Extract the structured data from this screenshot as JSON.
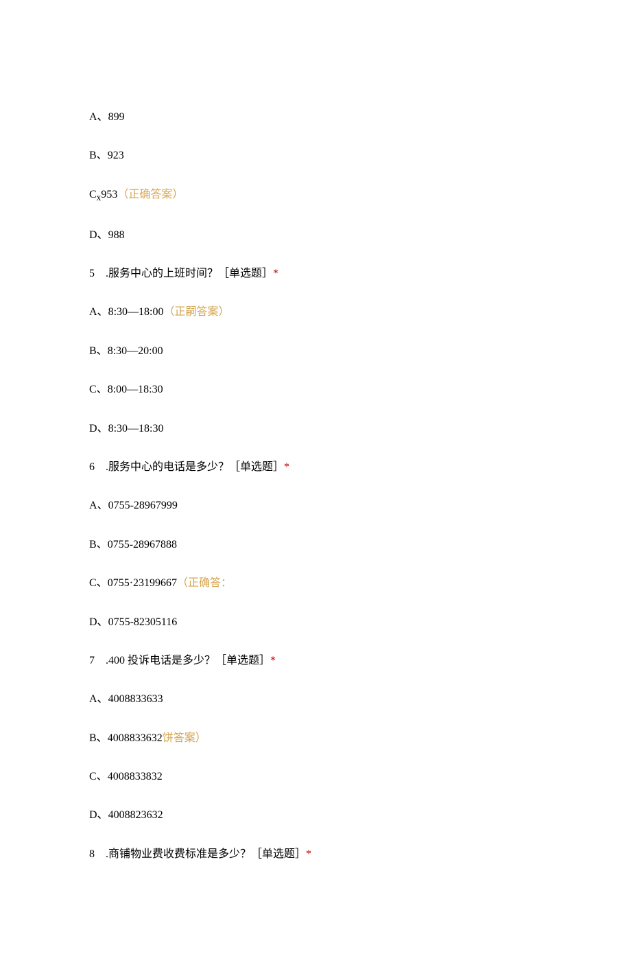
{
  "lines": [
    {
      "type": "option",
      "label": "A、",
      "value": "899"
    },
    {
      "type": "option",
      "label": "B、",
      "value": "923"
    },
    {
      "type": "option",
      "label": "C",
      "sub": "x",
      "value": "953",
      "correct": "（正确答案）"
    },
    {
      "type": "option",
      "label": "D、",
      "value": "988"
    },
    {
      "type": "question",
      "num": "5",
      "text": ".服务中心的上班时间？［单选题］",
      "req": "*"
    },
    {
      "type": "option",
      "label": "A、",
      "value": "8:30—18:00",
      "correct": "（正嗣答案）"
    },
    {
      "type": "option",
      "label": "B、",
      "value": "8:30—20:00"
    },
    {
      "type": "option",
      "label": "C、",
      "value": "8:00—18:30"
    },
    {
      "type": "option",
      "label": "D、",
      "value": "8:30—18:30"
    },
    {
      "type": "question",
      "num": "6",
      "text": ".服务中心的电话是多少？［单选题］",
      "req": "*"
    },
    {
      "type": "option",
      "label": "A、",
      "value": "0755-28967999"
    },
    {
      "type": "option",
      "label": "B、",
      "value": "0755-28967888"
    },
    {
      "type": "option",
      "label": "C、",
      "value": "0755·23199667",
      "correct": "（正确答："
    },
    {
      "type": "option",
      "label": "D、",
      "value": "0755-82305116"
    },
    {
      "type": "question",
      "num": "7",
      "text": ".400 投诉电话是多少？［单选题］",
      "req": "*"
    },
    {
      "type": "option",
      "label": "A、",
      "value": "4008833633"
    },
    {
      "type": "option",
      "label": "B、",
      "value": "4008833632",
      "correct": "饼答案）"
    },
    {
      "type": "option",
      "label": "C、",
      "value": "4008833832"
    },
    {
      "type": "option",
      "label": "D、",
      "value": "4008823632"
    },
    {
      "type": "question",
      "num": "8",
      "text": ".商铺物业费收费标准是多少？［单选题］",
      "req": "*"
    }
  ]
}
